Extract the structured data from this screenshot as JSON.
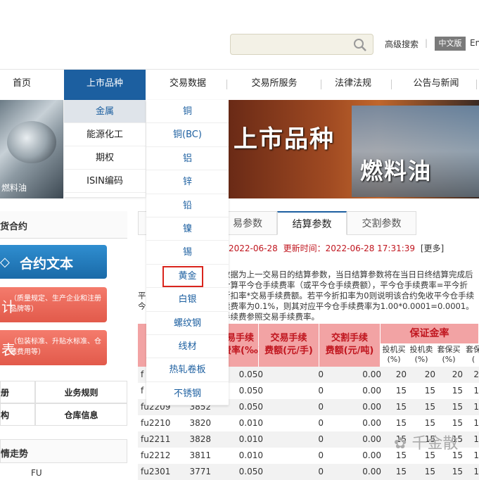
{
  "header": {
    "advanced_search": "高级搜索",
    "lang_cn": "中文版",
    "lang_en": "En"
  },
  "nav": [
    "首页",
    "上市品种",
    "交易数据",
    "交易所服务",
    "法律法规",
    "公告与新闻"
  ],
  "menu_l1": [
    "金属",
    "能源化工",
    "期权",
    "ISIN编码"
  ],
  "menu_l2": [
    "铜",
    "铜(BC)",
    "铝",
    "锌",
    "铅",
    "镍",
    "锡",
    "黄金",
    "白银",
    "螺纹钢",
    "线材",
    "热轧卷板",
    "不锈钢"
  ],
  "banner": {
    "title": "上市品种",
    "subtitle": "燃料油",
    "left_caption": "燃料油"
  },
  "sidebar": {
    "head": "货合约",
    "contract_text": "合约文本",
    "red1_big": "计",
    "red1_small": "（质量规定、生产企业和注册品牌等）",
    "red2_big": "表",
    "red2_small": "（包装标准、升贴水标准、仓储费用等）",
    "cells": [
      "册",
      "业务规则",
      "构",
      "仓库信息"
    ],
    "trend": "情走势",
    "fu": "FU"
  },
  "tabs": [
    "易参数",
    "结算参数",
    "交割参数"
  ],
  "date_line": {
    "date": "2022-06-28",
    "update_label": "更新时间：",
    "update_time": "2022-06-28 17:31:39",
    "more": "[更多]"
  },
  "paragraph": [
    "数据为上一交易日的结算参数，当日结算参数将在当日日终结算完成后",
    "计算平今仓手续费率（或平今仓手续费额），平今仓手续费率=平今折",
    "折扣率*交易手续费额。若平今折扣率为0则说明该合约免收平今仓手续",
    "续费率为0.1%，则其对应平今仓手续费率为1.00*0.0001=0.0001。",
    "手续费参照交易手续费率。"
  ],
  "paragraph_left": [
    "平",
    "今"
  ],
  "table": {
    "headers": {
      "rate": "易手续\n费率(‰)",
      "trade_fee": "交易手续\n费额(元/手)",
      "delivery_fee": "交割手续\n费额(元/吨)",
      "margin": "保证金率",
      "margin_sub": [
        "投机买\n(%)",
        "投机卖\n(%)",
        "套保买\n(%)",
        "套保\n("
      ]
    },
    "rows": [
      {
        "code": "f",
        "price": "",
        "rate": "0.050",
        "trade": "0",
        "deliv": "0.00",
        "m1": "20",
        "m2": "20",
        "m3": "20",
        "m4": "2"
      },
      {
        "code": "f",
        "price": "",
        "rate": "0.050",
        "trade": "0",
        "deliv": "0.00",
        "m1": "15",
        "m2": "15",
        "m3": "15",
        "m4": "1"
      },
      {
        "code": "fu2209",
        "price": "3852",
        "rate": "0.050",
        "trade": "0",
        "deliv": "0.00",
        "m1": "15",
        "m2": "15",
        "m3": "15",
        "m4": "1"
      },
      {
        "code": "fu2210",
        "price": "3820",
        "rate": "0.010",
        "trade": "0",
        "deliv": "0.00",
        "m1": "15",
        "m2": "15",
        "m3": "15",
        "m4": "1"
      },
      {
        "code": "fu2211",
        "price": "3828",
        "rate": "0.010",
        "trade": "0",
        "deliv": "0.00",
        "m1": "15",
        "m2": "15",
        "m3": "15",
        "m4": "1"
      },
      {
        "code": "fu2212",
        "price": "3811",
        "rate": "0.010",
        "trade": "0",
        "deliv": "0.00",
        "m1": "15",
        "m2": "15",
        "m3": "15",
        "m4": "1"
      },
      {
        "code": "fu2301",
        "price": "3771",
        "rate": "0.050",
        "trade": "0",
        "deliv": "0.00",
        "m1": "15",
        "m2": "15",
        "m3": "15",
        "m4": "1"
      }
    ]
  },
  "watermark": "千金散"
}
